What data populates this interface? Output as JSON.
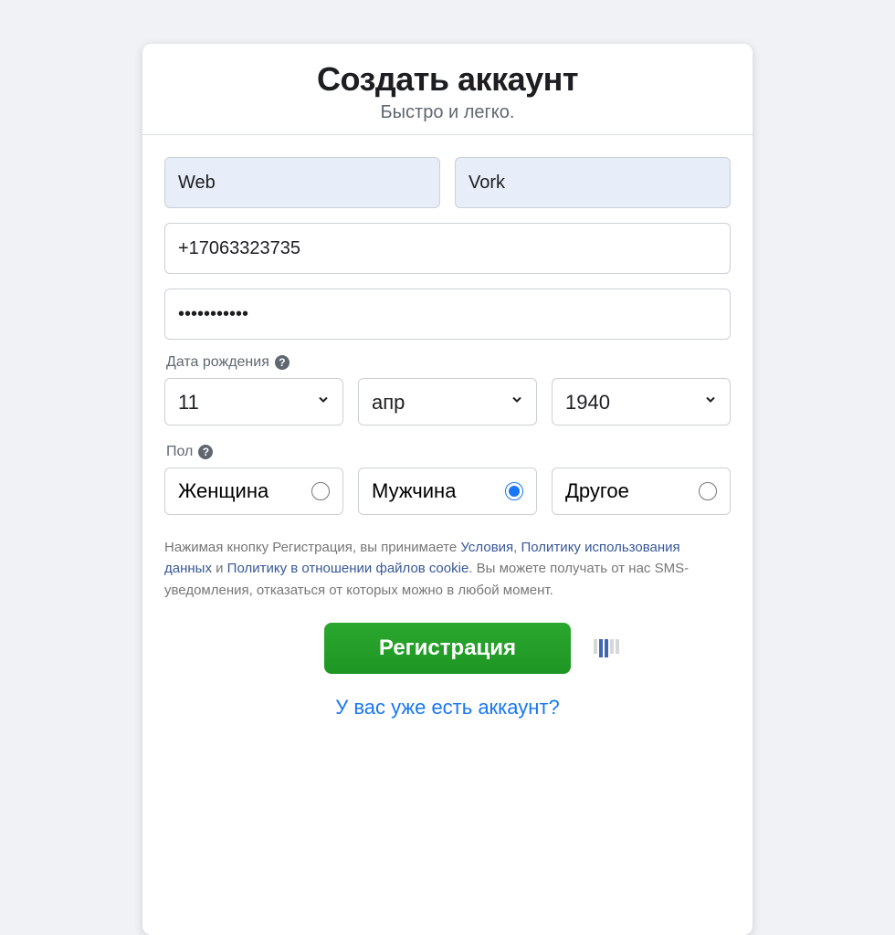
{
  "header": {
    "title": "Создать аккаунт",
    "subtitle": "Быстро и легко."
  },
  "fields": {
    "first_name": "Web",
    "last_name": "Vork",
    "contact": "+17063323735",
    "password": "•••••••••••"
  },
  "birthday": {
    "label": "Дата рождения",
    "day": "11",
    "month": "апр",
    "year": "1940"
  },
  "gender": {
    "label": "Пол",
    "options": {
      "female": "Женщина",
      "male": "Мужчина",
      "other": "Другое"
    },
    "selected": "male"
  },
  "legal": {
    "prefix": "Нажимая кнопку Регистрация, вы принимаете ",
    "terms": "Условия",
    "sep1": ", ",
    "data_policy": "Политику использования данных",
    "sep2": " и ",
    "cookie_policy": "Политику в отношении файлов cookie",
    "suffix": ". Вы можете получать от нас SMS-уведомления, отказаться от которых можно в любой момент."
  },
  "buttons": {
    "submit": "Регистрация",
    "login_link": "У вас уже есть аккаунт?"
  }
}
